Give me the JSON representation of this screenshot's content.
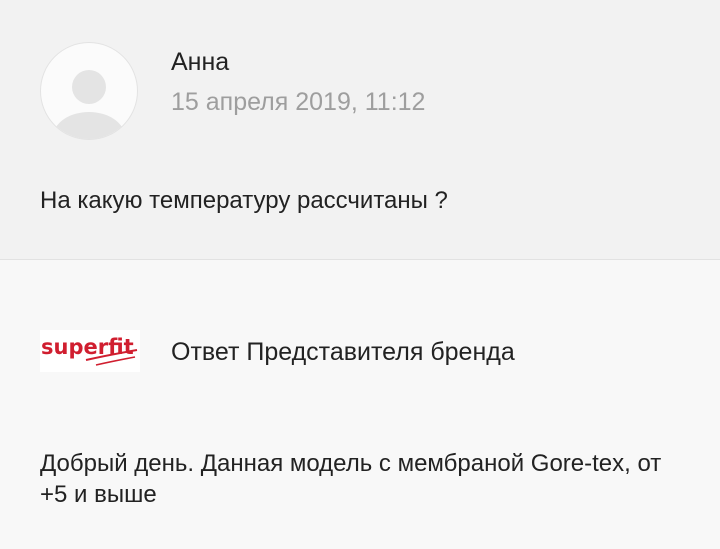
{
  "question": {
    "author": "Анна",
    "date": "15 апреля 2019, 11:12",
    "text": "На какую температуру рассчитаны ?",
    "avatar_icon": "default-user-avatar-icon"
  },
  "answer": {
    "brand_logo_text": "superfit",
    "brand_color": "#d01e2f",
    "label": "Ответ Представителя бренда",
    "text": "Добрый день. Данная модель с мембраной Gore-tex, от +5 и выше"
  }
}
